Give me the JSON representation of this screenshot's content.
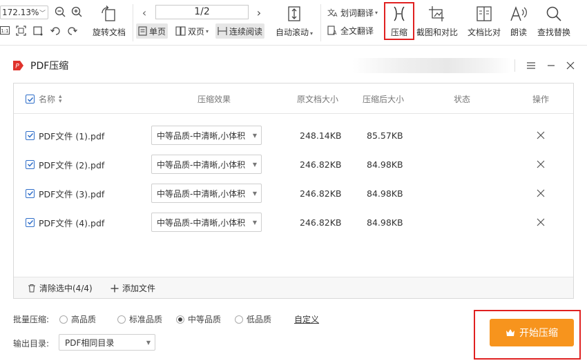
{
  "toolbar": {
    "zoom_value": "172.13%",
    "page_indicator": "1/2",
    "rotate_label": "旋转文档",
    "single_page_label": "单页",
    "double_page_label": "双页",
    "continuous_label": "连续阅读",
    "auto_scroll_label": "自动滚动",
    "word_translate_label": "划词翻译",
    "full_translate_label": "全文翻译",
    "compress_label": "压缩",
    "screenshot_compare_label": "截图和对比",
    "doc_compare_label": "文档比对",
    "read_aloud_label": "朗读",
    "find_replace_label": "查找替换",
    "highlight_color": "#e02020"
  },
  "dialog": {
    "title": "PDF压缩",
    "logo_text": "P",
    "brand_color": "#e0332c"
  },
  "table": {
    "headers": {
      "name": "名称",
      "effect": "压缩效果",
      "original_size": "原文档大小",
      "compressed_size": "压缩后大小",
      "status": "状态",
      "action": "操作"
    },
    "rows": [
      {
        "name": "PDF文件 (1).pdf",
        "effect": "中等品质-中清晰,小体积",
        "original_size": "248.14KB",
        "compressed_size": "85.57KB",
        "status": ""
      },
      {
        "name": "PDF文件 (2).pdf",
        "effect": "中等品质-中清晰,小体积",
        "original_size": "246.82KB",
        "compressed_size": "84.98KB",
        "status": ""
      },
      {
        "name": "PDF文件 (3).pdf",
        "effect": "中等品质-中清晰,小体积",
        "original_size": "246.82KB",
        "compressed_size": "84.98KB",
        "status": ""
      },
      {
        "name": "PDF文件 (4).pdf",
        "effect": "中等品质-中清晰,小体积",
        "original_size": "246.82KB",
        "compressed_size": "84.98KB",
        "status": ""
      }
    ],
    "clear_selected_label": "清除选中(4/4)",
    "add_file_label": "添加文件"
  },
  "settings": {
    "batch_label": "批量压缩:",
    "quality_options": [
      "高品质",
      "标准品质",
      "中等品质",
      "低品质"
    ],
    "selected_quality": "中等品质",
    "custom_label": "自定义",
    "output_label": "输出目录:",
    "output_value": "PDF相同目录"
  },
  "start_button": {
    "label": "开始压缩",
    "color": "#f7941d"
  }
}
